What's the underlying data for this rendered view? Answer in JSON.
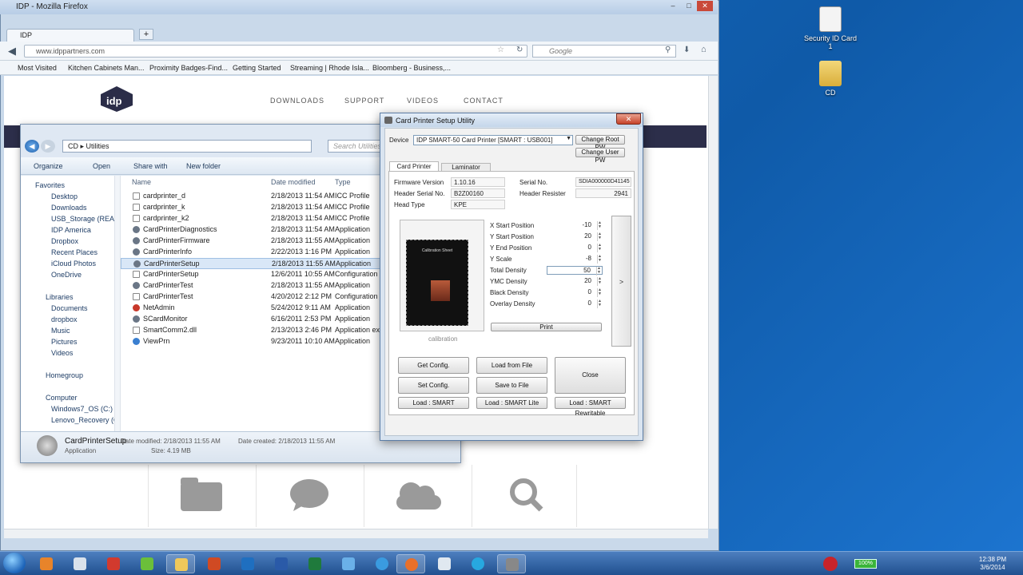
{
  "firefox": {
    "window_title": "IDP - Mozilla Firefox",
    "tab_label": "IDP",
    "url": "www.idppartners.com",
    "search_placeholder": "Google",
    "bookmarks": [
      "Most Visited",
      "Kitchen Cabinets Man...",
      "Proximity Badges-Find...",
      "Getting Started",
      "Streaming | Rhode Isla...",
      "Bloomberg - Business,..."
    ]
  },
  "site": {
    "nav": [
      "DOWNLOADS",
      "SUPPORT",
      "VIDEOS",
      "CONTACT"
    ]
  },
  "explorer": {
    "path": [
      "CD",
      "Utilities"
    ],
    "search_placeholder": "Search Utilities",
    "toolbar": {
      "organize": "Organize",
      "open": "Open",
      "share": "Share with",
      "new_folder": "New folder"
    },
    "nav": {
      "favorites": "Favorites",
      "favorites_items": [
        "Desktop",
        "Downloads",
        "USB_Storage (READYS",
        "IDP America",
        "Dropbox",
        "Recent Places",
        "iCloud Photos",
        "OneDrive"
      ],
      "libraries": "Libraries",
      "libraries_items": [
        "Documents",
        "dropbox",
        "Music",
        "Pictures",
        "Videos"
      ],
      "homegroup": "Homegroup",
      "computer": "Computer",
      "computer_items": [
        "Windows7_OS (C:)",
        "Lenovo_Recovery (Q:)"
      ]
    },
    "columns": {
      "name": "Name",
      "date": "Date modified",
      "type": "Type"
    },
    "files": [
      {
        "name": "cardprinter_d",
        "date": "2/18/2013 11:54 AM",
        "type": "ICC Profile"
      },
      {
        "name": "cardprinter_k",
        "date": "2/18/2013 11:54 AM",
        "type": "ICC Profile"
      },
      {
        "name": "cardprinter_k2",
        "date": "2/18/2013 11:54 AM",
        "type": "ICC Profile"
      },
      {
        "name": "CardPrinterDiagnostics",
        "date": "2/18/2013 11:54 AM",
        "type": "Application"
      },
      {
        "name": "CardPrinterFirmware",
        "date": "2/18/2013 11:55 AM",
        "type": "Application"
      },
      {
        "name": "CardPrinterInfo",
        "date": "2/22/2013 1:16 PM",
        "type": "Application"
      },
      {
        "name": "CardPrinterSetup",
        "date": "2/18/2013 11:55 AM",
        "type": "Application"
      },
      {
        "name": "CardPrinterSetup",
        "date": "12/6/2011 10:55 AM",
        "type": "Configuration s"
      },
      {
        "name": "CardPrinterTest",
        "date": "2/18/2013 11:55 AM",
        "type": "Application"
      },
      {
        "name": "CardPrinterTest",
        "date": "4/20/2012 2:12 PM",
        "type": "Configuration s"
      },
      {
        "name": "NetAdmin",
        "date": "5/24/2012 9:11 AM",
        "type": "Application"
      },
      {
        "name": "SCardMonitor",
        "date": "6/16/2011 2:53 PM",
        "type": "Application"
      },
      {
        "name": "SmartComm2.dll",
        "date": "2/13/2013 2:46 PM",
        "type": "Application exte"
      },
      {
        "name": "ViewPrn",
        "date": "9/23/2011 10:10 AM",
        "type": "Application"
      }
    ],
    "details": {
      "name": "CardPrinterSetup",
      "modified": "Date modified: 2/18/2013 11:55 AM",
      "created": "Date created: 2/18/2013 11:55 AM",
      "type": "Application",
      "size": "Size: 4.19 MB"
    }
  },
  "utility": {
    "title": "Card Printer Setup Utility",
    "device_label": "Device",
    "device_value": "IDP SMART-50 Card Printer  [SMART : USB001]",
    "change_root_pw": "Change Root PW",
    "change_user_pw": "Change User PW",
    "tabs": [
      "Card Printer",
      "Laminator"
    ],
    "info": {
      "firmware_label": "Firmware Version",
      "firmware_value": "1.10.16",
      "header_serial_label": "Header Serial No.",
      "header_serial_value": "B2Z00160",
      "head_type_label": "Head Type",
      "head_type_value": "KPE",
      "serial_label": "Serial No.",
      "serial_value": "SDIA000000D41145",
      "header_resister_label": "Header Resister",
      "header_resister_value": "2941"
    },
    "preview_caption": "calibration",
    "calib_sheet_title": "Calibration Sheet",
    "params": [
      {
        "label": "X Start Position",
        "value": "-10"
      },
      {
        "label": "Y Start Position",
        "value": "20"
      },
      {
        "label": "Y End Position",
        "value": "0"
      },
      {
        "label": "Y Scale",
        "value": "-8"
      },
      {
        "label": "Total Density",
        "value": "50"
      },
      {
        "label": "YMC Density",
        "value": "20"
      },
      {
        "label": "Black Density",
        "value": "0"
      },
      {
        "label": "Overlay Density",
        "value": "0"
      }
    ],
    "print_btn": "Print",
    "next_arrow": ">",
    "buttons": {
      "get_config": "Get Config.",
      "load_from_file": "Load from File",
      "set_config": "Set Config.",
      "save_to_file": "Save to File",
      "close": "Close",
      "load_smart": "Load : SMART",
      "load_smart_lite": "Load : SMART Lite",
      "load_smart_rewritable": "Load : SMART Rewritable"
    }
  },
  "desktop": {
    "icons": [
      "Security ID Card 1",
      "CD"
    ]
  },
  "taskbar": {
    "battery": "100%",
    "time": "12:38 PM",
    "date": "3/6/2014"
  }
}
